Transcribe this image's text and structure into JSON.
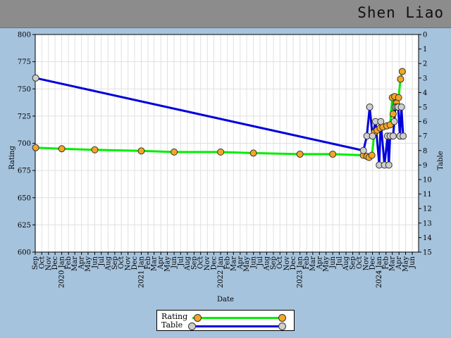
{
  "header": {
    "player_name": "Shen Liao"
  },
  "chart_data": {
    "type": "line",
    "title": "",
    "xlabel": "Date",
    "ylabel": "Rating",
    "y2label": "Table",
    "ylim": [
      600,
      800
    ],
    "y2lim": [
      0,
      15
    ],
    "y2_inverted": true,
    "yticks": [
      600,
      625,
      650,
      675,
      700,
      725,
      750,
      775,
      800
    ],
    "y2ticks": [
      0,
      1,
      2,
      3,
      4,
      5,
      6,
      7,
      8,
      9,
      10,
      11,
      12,
      13,
      14,
      15
    ],
    "xlim": [
      "2019-09-01",
      "2024-06-30"
    ],
    "grid": true,
    "legend_position": "bottom-center",
    "month_tick_labels": [
      "Sep",
      "Oct",
      "Nov",
      "Dec",
      "2020 Jan",
      "Feb",
      "Mar",
      "Apr",
      "May",
      "Jun",
      "Jul",
      "Aug",
      "Sep",
      "Oct",
      "Nov",
      "Dec",
      "2021 Jan",
      "Feb",
      "Mar",
      "Apr",
      "May",
      "Jun",
      "Jul",
      "Aug",
      "Sep",
      "Oct",
      "Nov",
      "Dec",
      "2022 Jan",
      "Feb",
      "Mar",
      "Apr",
      "May",
      "Jun",
      "Jul",
      "Aug",
      "Sep",
      "Oct",
      "Nov",
      "Dec",
      "2023 Jan",
      "Feb",
      "Mar",
      "Apr",
      "May",
      "Jun",
      "Jul",
      "Aug",
      "Sep",
      "Oct",
      "Nov",
      "Dec",
      "2024 Jan",
      "Feb",
      "Mar",
      "Apr",
      "May",
      "Jun"
    ],
    "series": [
      {
        "name": "Rating",
        "axis": "left",
        "line_color": "#00ee00",
        "marker_color": "#f5a623",
        "points": [
          [
            "2019-09-03",
            696
          ],
          [
            "2020-01-01",
            695
          ],
          [
            "2020-06-01",
            694
          ],
          [
            "2021-01-01",
            693
          ],
          [
            "2021-06-01",
            692
          ],
          [
            "2022-01-01",
            692
          ],
          [
            "2022-06-01",
            691
          ],
          [
            "2023-01-01",
            690
          ],
          [
            "2023-06-01",
            690
          ],
          [
            "2023-10-20",
            689
          ],
          [
            "2023-11-05",
            688
          ],
          [
            "2023-11-15",
            687
          ],
          [
            "2023-11-28",
            689
          ],
          [
            "2023-12-10",
            710
          ],
          [
            "2023-12-22",
            712
          ],
          [
            "2024-01-05",
            714
          ],
          [
            "2024-01-18",
            715
          ],
          [
            "2024-02-05",
            716
          ],
          [
            "2024-02-20",
            717
          ],
          [
            "2024-03-01",
            742
          ],
          [
            "2024-03-05",
            727
          ],
          [
            "2024-03-12",
            743
          ],
          [
            "2024-03-20",
            737
          ],
          [
            "2024-03-30",
            742
          ],
          [
            "2024-04-08",
            759
          ],
          [
            "2024-04-16",
            766
          ]
        ]
      },
      {
        "name": "Table",
        "axis": "right",
        "line_color": "#0000dd",
        "marker_color": "#cfcfcf",
        "points": [
          [
            "2019-09-03",
            3
          ],
          [
            "2023-10-20",
            8
          ],
          [
            "2023-11-05",
            7
          ],
          [
            "2023-11-18",
            5
          ],
          [
            "2023-12-01",
            7
          ],
          [
            "2023-12-15",
            6
          ],
          [
            "2024-01-01",
            9
          ],
          [
            "2024-01-08",
            6
          ],
          [
            "2024-01-25",
            9
          ],
          [
            "2024-02-08",
            7
          ],
          [
            "2024-02-14",
            9
          ],
          [
            "2024-02-20",
            7
          ],
          [
            "2024-03-05",
            7
          ],
          [
            "2024-03-10",
            6
          ],
          [
            "2024-03-15",
            5
          ],
          [
            "2024-03-22",
            5
          ],
          [
            "2024-03-28",
            5
          ],
          [
            "2024-04-05",
            7
          ],
          [
            "2024-04-12",
            5
          ],
          [
            "2024-04-20",
            7
          ]
        ]
      }
    ]
  }
}
